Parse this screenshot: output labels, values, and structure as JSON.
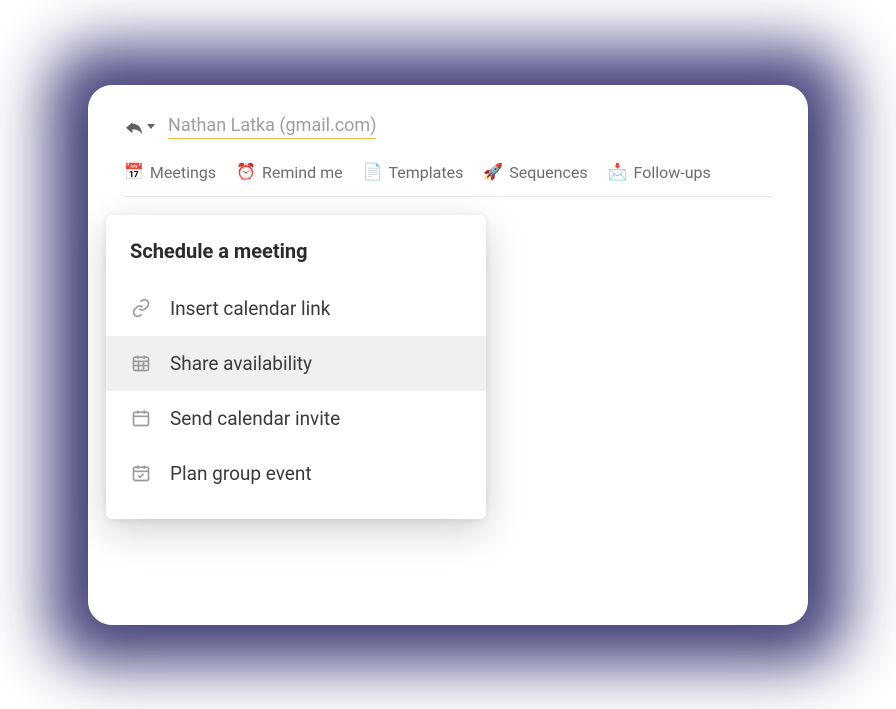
{
  "recipient": {
    "name": "Nathan Latka (gmail.com)"
  },
  "toolbar": {
    "meetings": "Meetings",
    "remind_me": "Remind me",
    "templates": "Templates",
    "sequences": "Sequences",
    "follow_ups": "Follow-ups"
  },
  "dropdown": {
    "title": "Schedule a meeting",
    "items": [
      {
        "label": "Insert calendar link",
        "icon": "link",
        "highlighted": false
      },
      {
        "label": "Share availability",
        "icon": "calendar-grid",
        "highlighted": true
      },
      {
        "label": "Send calendar invite",
        "icon": "calendar",
        "highlighted": false
      },
      {
        "label": "Plan group event",
        "icon": "calendar-check",
        "highlighted": false
      }
    ]
  },
  "icons": {
    "meetings_emoji": "📅",
    "remind_emoji": "⏰",
    "templates_emoji": "📄",
    "sequences_emoji": "🚀",
    "followups_emoji": "📩"
  }
}
